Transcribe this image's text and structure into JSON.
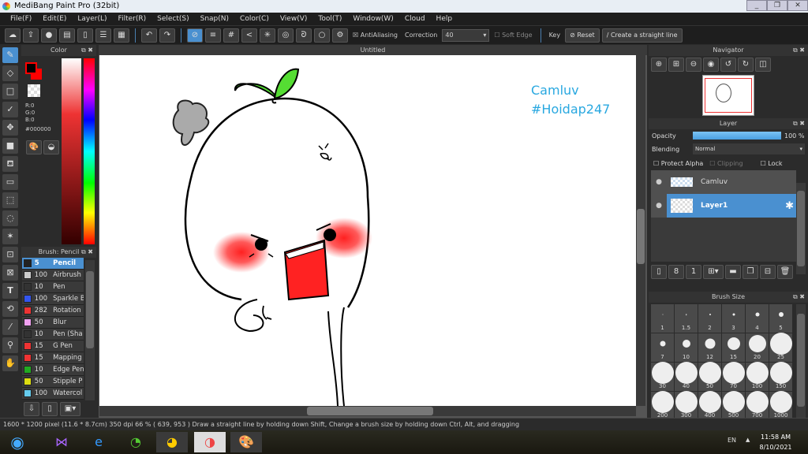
{
  "title": "MediBang Paint Pro (32bit)",
  "menu": [
    "File(F)",
    "Edit(E)",
    "Layer(L)",
    "Filter(R)",
    "Select(S)",
    "Snap(N)",
    "Color(C)",
    "View(V)",
    "Tool(T)",
    "Window(W)",
    "Cloud",
    "Help"
  ],
  "toolbar": {
    "antialiasing": "AntiAliasing",
    "correction_label": "Correction",
    "correction_value": "40",
    "soft_edge": "Soft Edge",
    "key": "Key",
    "reset": "Reset",
    "straight_line": "Create a straight line"
  },
  "color_panel": {
    "title": "Color",
    "r": "R:0",
    "g": "G:0",
    "b": "B:0",
    "hex": "#000000",
    "primary": "#000000",
    "secondary": "#ff0000"
  },
  "brush_panel": {
    "title": "Brush: Pencil",
    "items": [
      {
        "size": "5",
        "name": "Pencil",
        "color": "#222222"
      },
      {
        "size": "100",
        "name": "Airbrush",
        "color": "#cccccc"
      },
      {
        "size": "10",
        "name": "Pen",
        "color": "#333333"
      },
      {
        "size": "100",
        "name": "Sparkle B",
        "color": "#3355ee"
      },
      {
        "size": "282",
        "name": "Rotation",
        "color": "#ee3333"
      },
      {
        "size": "50",
        "name": "Blur",
        "color": "#f0a0f0"
      },
      {
        "size": "10",
        "name": "Pen (Sha",
        "color": "#333333"
      },
      {
        "size": "15",
        "name": "G Pen",
        "color": "#ee3333"
      },
      {
        "size": "15",
        "name": "Mapping",
        "color": "#ee3333"
      },
      {
        "size": "10",
        "name": "Edge Pen",
        "color": "#22aa22"
      },
      {
        "size": "50",
        "name": "Stipple P",
        "color": "#dddd11"
      },
      {
        "size": "100",
        "name": "Watercol",
        "color": "#66ccee"
      }
    ]
  },
  "canvas": {
    "tab": "Untitled",
    "text1": "Camluv",
    "text2": "#Hoidap247",
    "text_color": "#29a8e0"
  },
  "navigator": {
    "title": "Navigator"
  },
  "layer_panel": {
    "title": "Layer",
    "opacity_label": "Opacity",
    "opacity_value": "100 %",
    "opacity": 100,
    "blending_label": "Blending",
    "blending_value": "Normal",
    "protect_alpha": "Protect Alpha",
    "clipping": "Clipping",
    "lock": "Lock",
    "layers": [
      {
        "name": "Camluv",
        "selected": false
      },
      {
        "name": "Layer1",
        "selected": true
      }
    ]
  },
  "brush_size": {
    "title": "Brush Size",
    "sizes": [
      "1",
      "1.5",
      "2",
      "3",
      "4",
      "5",
      "7",
      "10",
      "12",
      "15",
      "20",
      "25",
      "30",
      "40",
      "50",
      "70",
      "100",
      "150",
      "200",
      "300",
      "400",
      "500",
      "700",
      "1000"
    ]
  },
  "status": "1600 * 1200 pixel  (11.6 * 8.7cm)  350 dpi  66 %  ( 639, 953 )  Draw a straight line by holding down Shift, Change a brush size by holding down Ctrl, Alt, and dragging",
  "taskbar": {
    "lang": "EN",
    "time": "11:58 AM",
    "date": "8/10/2021"
  }
}
